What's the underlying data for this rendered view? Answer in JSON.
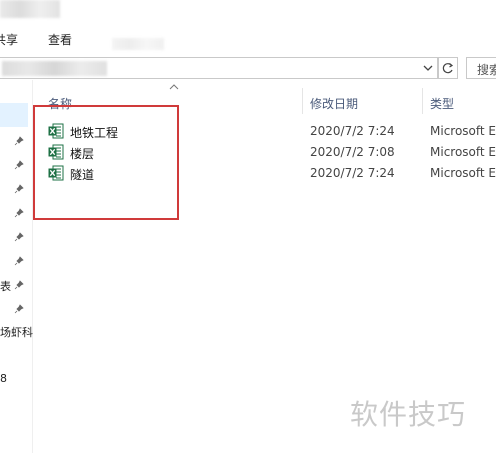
{
  "ribbon": {
    "tabs": [
      "共享",
      "查看"
    ]
  },
  "search": {
    "placeholder": "搜索"
  },
  "nav": {
    "items": [
      "表",
      "场虾科",
      "8"
    ]
  },
  "columns": {
    "name": "名称",
    "date": "修改日期",
    "type": "类型"
  },
  "files": [
    {
      "name": "地铁工程",
      "date": "2020/7/2 7:24",
      "type": "Microsoft E"
    },
    {
      "name": "楼层",
      "date": "2020/7/2 7:08",
      "type": "Microsoft E"
    },
    {
      "name": "隧道",
      "date": "2020/7/2 7:24",
      "type": "Microsoft E"
    }
  ],
  "watermark": "软件技巧",
  "colors": {
    "highlight": "#d03a3a",
    "excel_green": "#1d7044",
    "header_text": "#4a5a7a"
  }
}
